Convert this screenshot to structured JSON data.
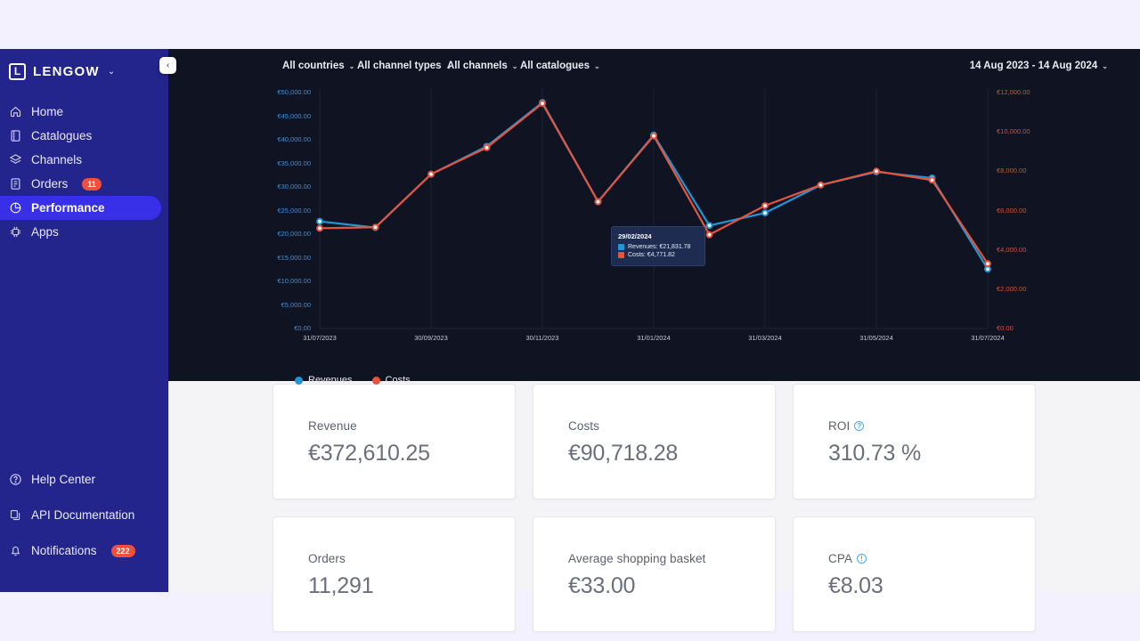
{
  "brand": {
    "name": "LENGOW",
    "mark": "L",
    "caret": "⌄"
  },
  "sidebar": {
    "items": [
      {
        "label": "Home",
        "icon": "home-icon",
        "badge": null,
        "active": false
      },
      {
        "label": "Catalogues",
        "icon": "catalogue-icon",
        "badge": null,
        "active": false
      },
      {
        "label": "Channels",
        "icon": "layers-icon",
        "badge": null,
        "active": false
      },
      {
        "label": "Orders",
        "icon": "orders-icon",
        "badge": "11",
        "active": false
      },
      {
        "label": "Performance",
        "icon": "chart-pie-icon",
        "badge": null,
        "active": true
      },
      {
        "label": "Apps",
        "icon": "apps-gear-icon",
        "badge": null,
        "active": false
      }
    ],
    "bottom_items": [
      {
        "label": "Help Center",
        "icon": "help-circle-icon",
        "badge": null
      },
      {
        "label": "API Documentation",
        "icon": "docs-icon",
        "badge": null
      },
      {
        "label": "Notifications",
        "icon": "bell-icon",
        "badge": "222"
      }
    ],
    "collapse_icon": "‹",
    "accent": "#3730e8",
    "background": "#23248c",
    "badge_color": "#ef4f3b"
  },
  "filters": {
    "countries": "All countries",
    "channel_types": "All channel types",
    "channels": "All channels",
    "catalogues": "All catalogues",
    "date_range": "14 Aug 2023 - 14 Aug 2024",
    "caret": "⌄"
  },
  "tooltip": {
    "date": "29/02/2024",
    "revenues_label": "Revenues: €21,831.78",
    "costs_label": "Costs: €4,771.82"
  },
  "kpis": [
    {
      "label": "Revenue",
      "value": "€372,610.25",
      "info": false
    },
    {
      "label": "Costs",
      "value": "€90,718.28",
      "info": false
    },
    {
      "label": "ROI",
      "value": "310.73 %",
      "info": true
    },
    {
      "label": "Orders",
      "value": "11,291",
      "info": false
    },
    {
      "label": "Average shopping basket",
      "value": "€33.00",
      "info": false
    },
    {
      "label": "CPA",
      "value": "€8.03",
      "info": true
    }
  ],
  "chart_data": {
    "type": "line",
    "title": "",
    "xlabel": "",
    "grid": true,
    "legend_position": "bottom-left",
    "colors": {
      "revenues": "#2196d6",
      "costs": "#e4543f"
    },
    "x_tick_labels": [
      "31/07/2023",
      "30/09/2023",
      "30/11/2023",
      "31/01/2024",
      "31/03/2024",
      "31/05/2024",
      "31/07/2024"
    ],
    "x_points": [
      "31/08/2023",
      "30/09/2023",
      "31/10/2023",
      "30/11/2023",
      "31/12/2023",
      "31/01/2024",
      "29/02/2024",
      "31/03/2024",
      "30/04/2024",
      "31/05/2024",
      "30/06/2024",
      "31/07/2024"
    ],
    "left_axis": {
      "label": "Revenues",
      "ylim": [
        0,
        50000
      ],
      "ticks": [
        "€0.00",
        "€5,000.00",
        "€10,000.00",
        "€15,000.00",
        "€20,000.00",
        "€25,000.00",
        "€30,000.00",
        "€35,000.00",
        "€40,000.00",
        "€45,000.00",
        "€50,000.00"
      ]
    },
    "right_axis": {
      "label": "Costs",
      "ylim": [
        0,
        12000
      ],
      "ticks": [
        "€0.00",
        "€2,000.00",
        "€4,000.00",
        "€6,000.00",
        "€8,000.00",
        "€10,000.00",
        "€12,000.00"
      ]
    },
    "series": [
      {
        "name": "Revenues",
        "axis": "left",
        "color": "#2196d6",
        "values": [
          22700,
          21400,
          32700,
          38600,
          47900,
          26900,
          41000,
          21831.78,
          24500,
          30400,
          33200,
          31900,
          12600
        ]
      },
      {
        "name": "Costs",
        "axis": "right",
        "color": "#e4543f",
        "values": [
          5100,
          5150,
          7850,
          9200,
          11450,
          6450,
          9800,
          4771.82,
          6250,
          7300,
          8000,
          7550,
          3300
        ]
      }
    ]
  }
}
